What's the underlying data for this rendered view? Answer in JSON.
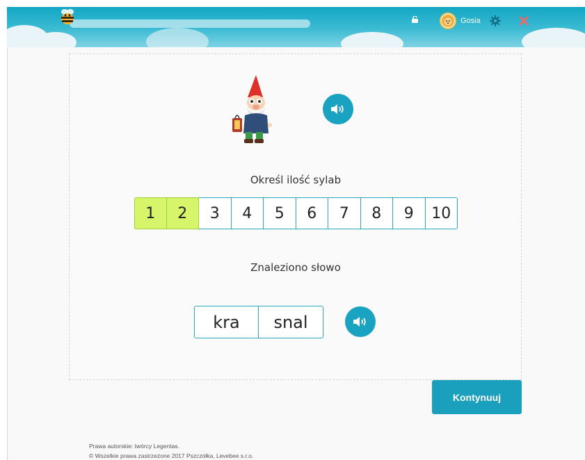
{
  "header": {
    "username": "Gosia",
    "progress": 0.0,
    "icons": {
      "logo": "bee-icon",
      "lock": "unlock-icon",
      "avatar": "lion-avatar",
      "settings": "gear-icon",
      "close": "close-icon"
    },
    "colors": {
      "header": "#13a7c4",
      "close": "#e96a6a"
    }
  },
  "exercise": {
    "character": "gnome-with-lantern",
    "prompt_label": "Określ ilość sylab",
    "syllable_options": [
      "1",
      "2",
      "3",
      "4",
      "5",
      "6",
      "7",
      "8",
      "9",
      "10"
    ],
    "selected_count": 2,
    "found_label": "Znaleziono słowo",
    "word_parts": [
      "kra",
      "snal"
    ],
    "colors": {
      "selected": "#d6f56b",
      "accent": "#1aa3c0"
    }
  },
  "actions": {
    "continue_label": "Kontynuuj"
  },
  "footer": {
    "line1": "Prawa autorskie: twórcy Legentas.",
    "line2": "© Wszelkie prawa zastrzeżone 2017 Pszczółka, Levebee s.r.o."
  }
}
